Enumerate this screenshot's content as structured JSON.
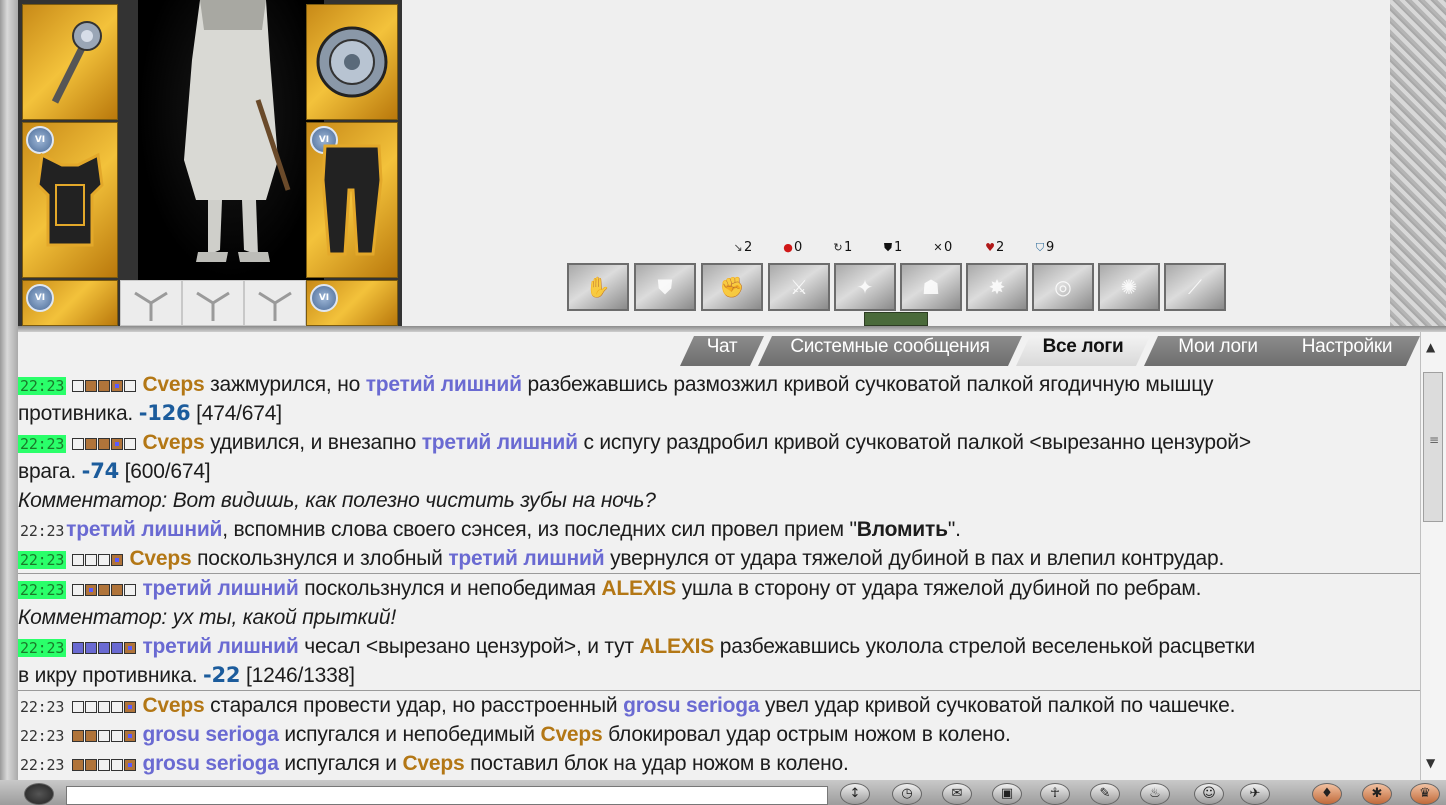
{
  "stats": [
    {
      "icon": "weapon-icon",
      "sym": "↘",
      "value": "2",
      "color": "#444"
    },
    {
      "icon": "blood-drop-icon",
      "sym": "●",
      "value": "0",
      "color": "#d01818"
    },
    {
      "icon": "counter-icon",
      "sym": "↻",
      "value": "1",
      "color": "#222"
    },
    {
      "icon": "shield-icon",
      "sym": "⛊",
      "value": "1",
      "color": "#111"
    },
    {
      "icon": "crossed-swords-icon",
      "sym": "✕",
      "value": "0",
      "color": "#222"
    },
    {
      "icon": "heart-icon",
      "sym": "♥",
      "value": "2",
      "color": "#b01818"
    },
    {
      "icon": "defense-shield-icon",
      "sym": "⛉",
      "value": "9",
      "color": "#2a6a9a"
    }
  ],
  "tabs": [
    {
      "label": "Чат",
      "active": false
    },
    {
      "label": "Системные сообщения",
      "active": false
    },
    {
      "label": "Все логи",
      "active": true
    },
    {
      "label": "Мои логи",
      "active": false
    },
    {
      "label": "Настройки",
      "active": false
    }
  ],
  "log": {
    "l1": {
      "time": "22:23",
      "a": "Cveps",
      "t1": " зажмурился, но ",
      "b": "третий лишний",
      "t2": " разбежавшись размозжил кривой сучковатой палкой ягодичную мышцу"
    },
    "l1b": {
      "t": "противника. ",
      "dmg": "-126",
      "hp": " [474/674]"
    },
    "l2": {
      "time": "22:23",
      "a": "Cveps",
      "t1": " удивился, и внезапно ",
      "b": "третий лишний",
      "t2": " с испугу раздробил кривой сучковатой палкой <вырезанно цензурой>"
    },
    "l2b": {
      "t": "врага. ",
      "dmg": "-74",
      "hp": " [600/674]"
    },
    "l3": {
      "comment": "Комментатор: Вот видишь, как полезно чистить зубы на ночь?"
    },
    "l4": {
      "time": "22:23",
      "b": "третий лишний",
      "t1": ", вспомнив слова своего сэнсея, из последних сил провел прием \"",
      "bold": "Вломить",
      "t2": "\"."
    },
    "l5": {
      "time": "22:23",
      "a": "Cveps",
      "t1": " поскользнулся и злобный ",
      "b": "третий лишний",
      "t2": " увернулся от удара тяжелой дубиной в пах и влепил контрудар."
    },
    "l6": {
      "time": "22:23",
      "b": "третий лишний",
      "t1": " поскользнулся и непобедимая ",
      "a": "ALEXIS",
      "t2": " ушла в сторону от удара тяжелой дубиной по ребрам."
    },
    "l7": {
      "comment": "Комментатор: ух ты, какой прыткий!"
    },
    "l8": {
      "time": "22:23",
      "b": "третий лишний",
      "t1": " чесал <вырезано цензурой>, и тут ",
      "a": "ALEXIS",
      "t2": " разбежавшись уколола стрелой веселенькой расцветки"
    },
    "l8b": {
      "t": "в икру противника. ",
      "dmg": "-22",
      "hp": " [1246/1338]"
    },
    "l9": {
      "time": "22:23",
      "a": "Cveps",
      "t1": " старался провести удар, но расстроенный ",
      "b": "grosu serioga",
      "t2": " увел удар кривой сучковатой палкой по чашечке."
    },
    "l10": {
      "time": "22:23",
      "b": "grosu serioga",
      "t1": " испугался и непобедимый ",
      "a": "Cveps",
      "t2": " блокировал удар острым ножом в колено."
    },
    "l11": {
      "time": "22:23",
      "b": "grosu serioga",
      "t1": " испугался и ",
      "a": "Cveps",
      "t2": " поставил блок на удар ножом в колено."
    }
  },
  "colors": {
    "highlight_time": "#2aff6a",
    "name_orange": "#b37715",
    "name_blue": "#6a6ad2",
    "damage": "#1c5c9c"
  }
}
